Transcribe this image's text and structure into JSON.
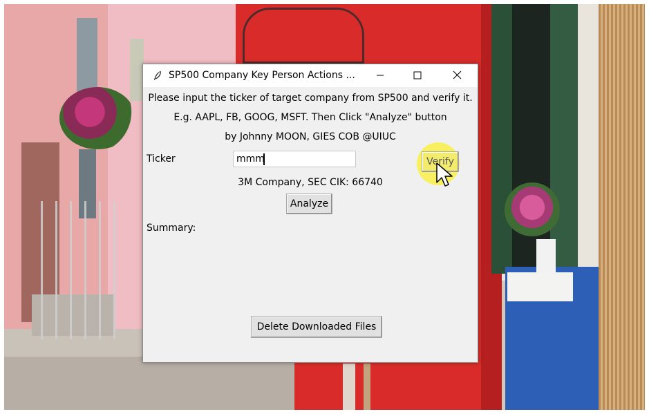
{
  "window": {
    "title": "SP500 Company Key Person Actions ...",
    "controls": [
      "minimize",
      "maximize",
      "close"
    ]
  },
  "instructions": {
    "line1": "Please input the ticker of target company from SP500 and verify it.",
    "line2": "E.g. AAPL, FB, GOOG, MSFT. Then Click \"Analyze\" button",
    "line3": "by Johnny MOON, GIES COB @UIUC"
  },
  "form": {
    "ticker_label": "Ticker",
    "ticker_value": "mmm",
    "verify_label": "Verify",
    "result_text": "3M Company, SEC CIK: 66740",
    "analyze_label": "Analyze",
    "summary_label": "Summary:",
    "delete_label": "Delete Downloaded Files"
  },
  "icons": {
    "app": "feather-icon",
    "minimize": "minimize-icon",
    "maximize": "maximize-icon",
    "close": "close-icon",
    "cursor": "mouse-pointer-icon"
  },
  "colors": {
    "window_bg": "#f0f0f0",
    "titlebar_bg": "#ffffff",
    "cursor_highlight": "#faf03c"
  }
}
